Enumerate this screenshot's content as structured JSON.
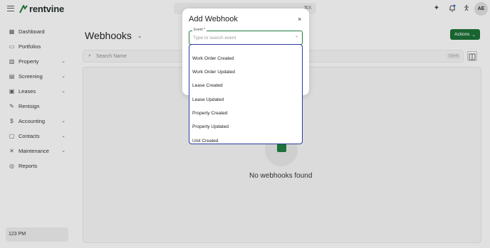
{
  "app": {
    "logo_text": "rentvine",
    "user_initials": "AE",
    "search_shortcut": "⌘K"
  },
  "sidebar": {
    "items": [
      {
        "label": "Dashboard",
        "icon": "grid-icon",
        "has_chevron": false
      },
      {
        "label": "Portfolios",
        "icon": "folder-icon",
        "has_chevron": false
      },
      {
        "label": "Property",
        "icon": "building-icon",
        "has_chevron": true
      },
      {
        "label": "Screening",
        "icon": "screening-icon",
        "has_chevron": true
      },
      {
        "label": "Leases",
        "icon": "lease-icon",
        "has_chevron": true
      },
      {
        "label": "Rentsign",
        "icon": "signature-icon",
        "has_chevron": false
      },
      {
        "label": "Accounting",
        "icon": "dollar-icon",
        "has_chevron": true
      },
      {
        "label": "Contacts",
        "icon": "contacts-icon",
        "has_chevron": true
      },
      {
        "label": "Maintenance",
        "icon": "wrench-icon",
        "has_chevron": true
      },
      {
        "label": "Reports",
        "icon": "reports-icon",
        "has_chevron": false
      }
    ],
    "time": "123 PM"
  },
  "main": {
    "title": "Webhooks",
    "actions_label": "Actions",
    "search_placeholder": "Search Name",
    "search_shortcut": "Ctrl+K",
    "empty_text": "No webhooks found"
  },
  "modal": {
    "title": "Add Webhook",
    "close": "×",
    "event_label": "Event *",
    "event_placeholder": "Type to search event",
    "options": [
      "Work Order Created",
      "Work Order Updated",
      "Lease Created",
      "Lease Updated",
      "Property Created",
      "Property Updated",
      "Unit Created"
    ]
  },
  "colors": {
    "brand_green": "#1b6b35",
    "focus_blue": "#2d3aa3"
  }
}
